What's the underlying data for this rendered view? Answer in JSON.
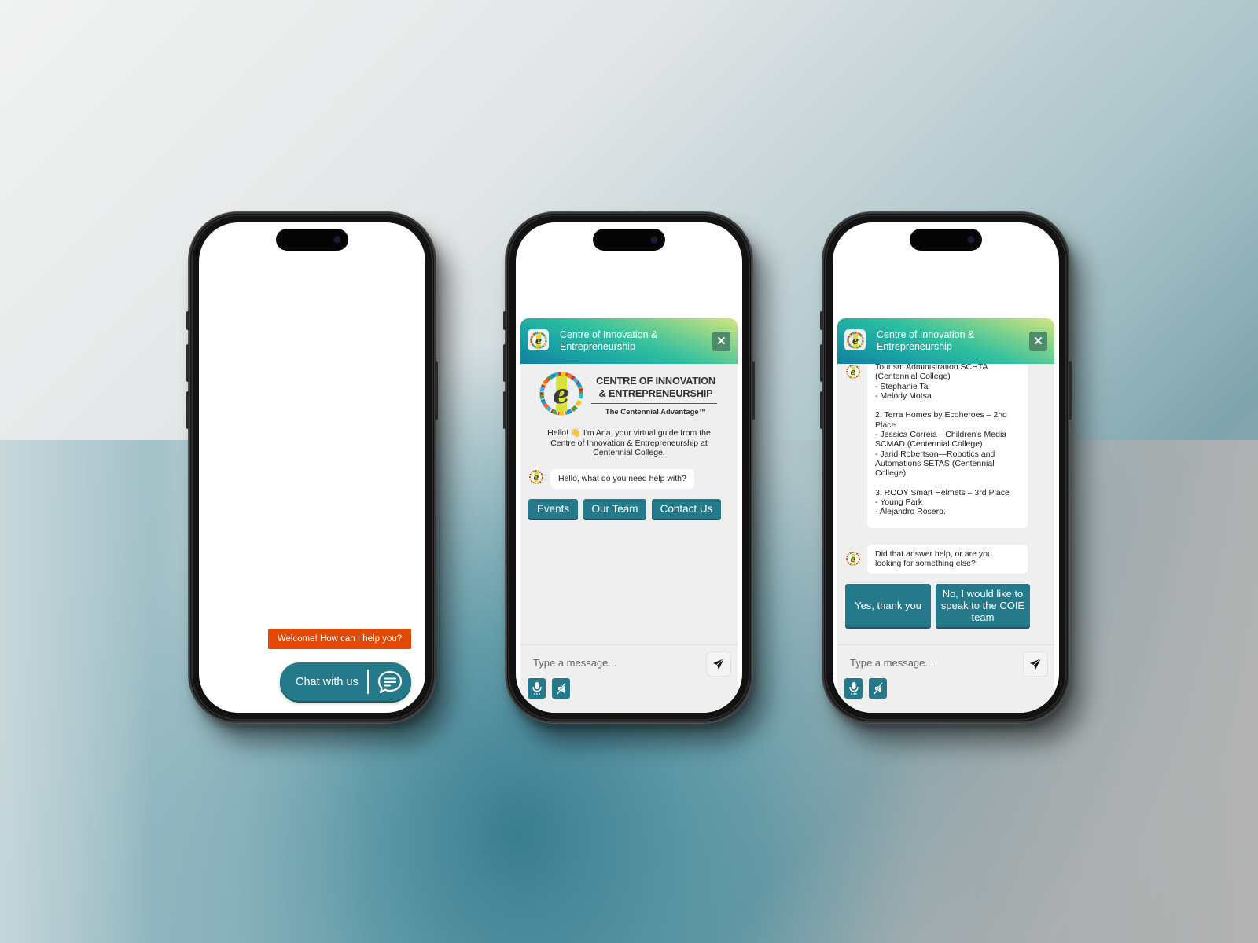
{
  "launcher_screen": {
    "welcome_banner": "Welcome! How can I help you?",
    "chat_button_label": "Chat with us",
    "chat_button_icon": "chat-bubble-icon",
    "colors": {
      "banner": "#e24906",
      "button": "#24798a"
    }
  },
  "chat_header": {
    "title": "Centre of Innovation & Entrepreneurship",
    "close_label": "✕",
    "gradient": [
      "#d4e67c",
      "#2fbf9e",
      "#137f9f"
    ]
  },
  "welcome_screen": {
    "brand_name": "CENTRE OF INNOVATION & ENTREPRENEURSHIP",
    "brand_tagline": "The Centennial Advantage™",
    "intro_text": "Hello! 👋 I'm Aria, your virtual guide from the Centre of Innovation & Entrepreneurship at Centennial College.",
    "bot_message": "Hello, what do you need help with?",
    "quick_replies": [
      "Events",
      "Our Team",
      "Contact Us"
    ]
  },
  "answer_screen": {
    "bot_answer_lines": [
      "Tourism Administration SCHTA",
      "(Centennial College)",
      "- Stephanie Ta",
      "- Melody Motsa",
      "",
      "2. Terra Homes by Ecoheroes – 2nd",
      "Place",
      "- Jessica Correia—Children's Media",
      "SCMAD (Centennial College)",
      "- Jarid Robertson—Robotics and",
      "Automations SETAS (Centennial",
      "College)",
      "",
      "3. ROOY Smart Helmets – 3rd Place",
      "- Young Park",
      "- Alejandro Rosero."
    ],
    "followup_message": "Did that answer help, or are you looking for something else?",
    "quick_replies": [
      "Yes, thank you",
      "No, I would like to speak to the COIE team"
    ]
  },
  "composer": {
    "placeholder": "Type a message...",
    "value": "",
    "send_icon": "paper-plane-icon",
    "mic_icon": "microphone-icon",
    "mute_icon": "speaker-muted-icon"
  }
}
